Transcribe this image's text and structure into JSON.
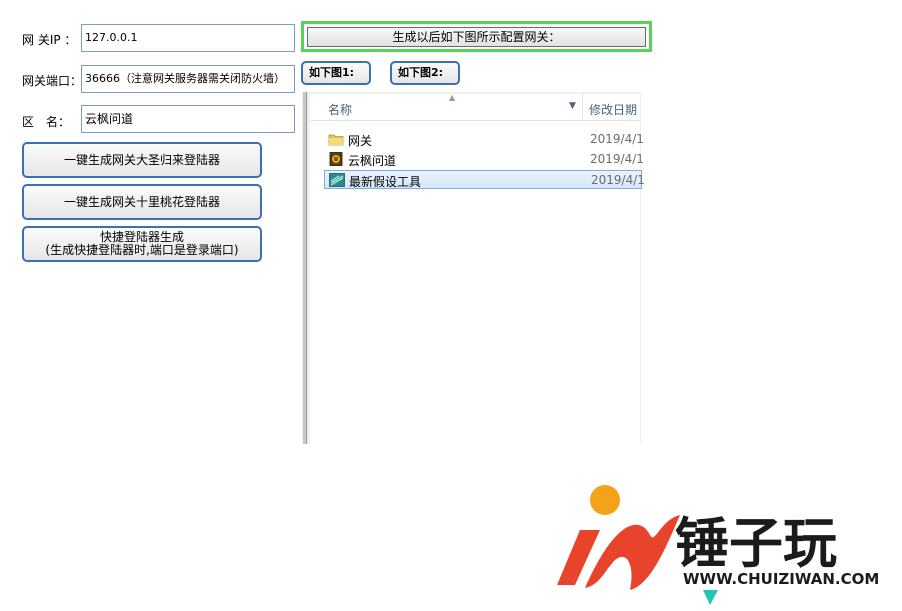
{
  "form": {
    "gateway_ip_label": "网 关IP ：",
    "gateway_ip_value": "127.0.0.1",
    "gateway_port_label": "网关端口：",
    "gateway_port_value": "36666（注意网关服务器需关闭防火墙）",
    "zone_name_label": "区　名：",
    "zone_name_value": "云枫问道"
  },
  "buttons": {
    "gen_dazhi": "一键生成网关大圣归来登陆器",
    "gen_shili": "一键生成网关十里桃花登陆器",
    "quick_line1": "快捷登陆器生成",
    "quick_line2": "(生成快捷登陆器时,端口是登录端口)",
    "configure_hint": "生成以后如下图所示配置网关：",
    "fig1": "如下图1:",
    "fig2": "如下图2:"
  },
  "explorer": {
    "col_name": "名称",
    "col_date": "修改日期",
    "items": [
      {
        "name": "网关",
        "date": "2019/4/1",
        "icon": "folder-icon",
        "selected": false
      },
      {
        "name": "云枫问道",
        "date": "2019/4/1",
        "icon": "game-exe-icon",
        "selected": false
      },
      {
        "name": "最新假设工具",
        "date": "2019/4/1",
        "icon": "tool-exe-icon",
        "selected": true
      }
    ]
  },
  "watermark": {
    "brand": "锤子玩",
    "url": "WWW.CHUIZIWAN.COM",
    "colors": {
      "orange": "#f5a21b",
      "red": "#e8432b",
      "teal": "#1fc7b5"
    }
  }
}
